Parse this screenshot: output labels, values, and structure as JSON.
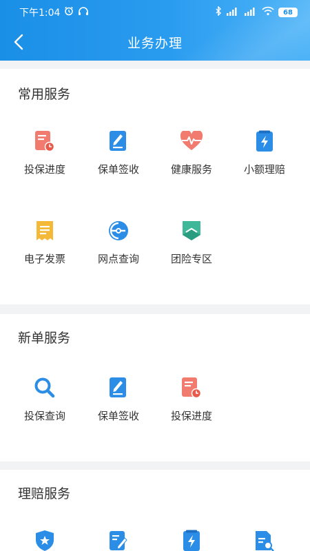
{
  "status_bar": {
    "time": "下午1:04",
    "battery": "68"
  },
  "header": {
    "title": "业务办理",
    "colors": {
      "primary": "#1a8fe6",
      "accent": "#4fb4f7"
    }
  },
  "sections": {
    "common": {
      "title": "常用服务",
      "items": [
        {
          "label": "投保进度",
          "icon": "insure-progress-icon"
        },
        {
          "label": "保单签收",
          "icon": "policy-sign-icon"
        },
        {
          "label": "健康服务",
          "icon": "heart-pulse-icon"
        },
        {
          "label": "小额理赔",
          "icon": "lightning-claim-icon"
        },
        {
          "label": "电子发票",
          "icon": "receipt-icon"
        },
        {
          "label": "网点查询",
          "icon": "network-search-icon"
        },
        {
          "label": "团险专区",
          "icon": "group-insurance-icon"
        }
      ]
    },
    "new_policy": {
      "title": "新单服务",
      "items": [
        {
          "label": "投保查询",
          "icon": "search-icon"
        },
        {
          "label": "保单签收",
          "icon": "policy-sign-icon"
        },
        {
          "label": "投保进度",
          "icon": "insure-progress-icon"
        }
      ]
    },
    "claims": {
      "title": "理赔服务",
      "items": [
        {
          "icon": "shield-star-icon"
        },
        {
          "icon": "edit-doc-icon"
        },
        {
          "icon": "lightning-claim-icon"
        },
        {
          "icon": "doc-search-icon"
        }
      ]
    }
  }
}
